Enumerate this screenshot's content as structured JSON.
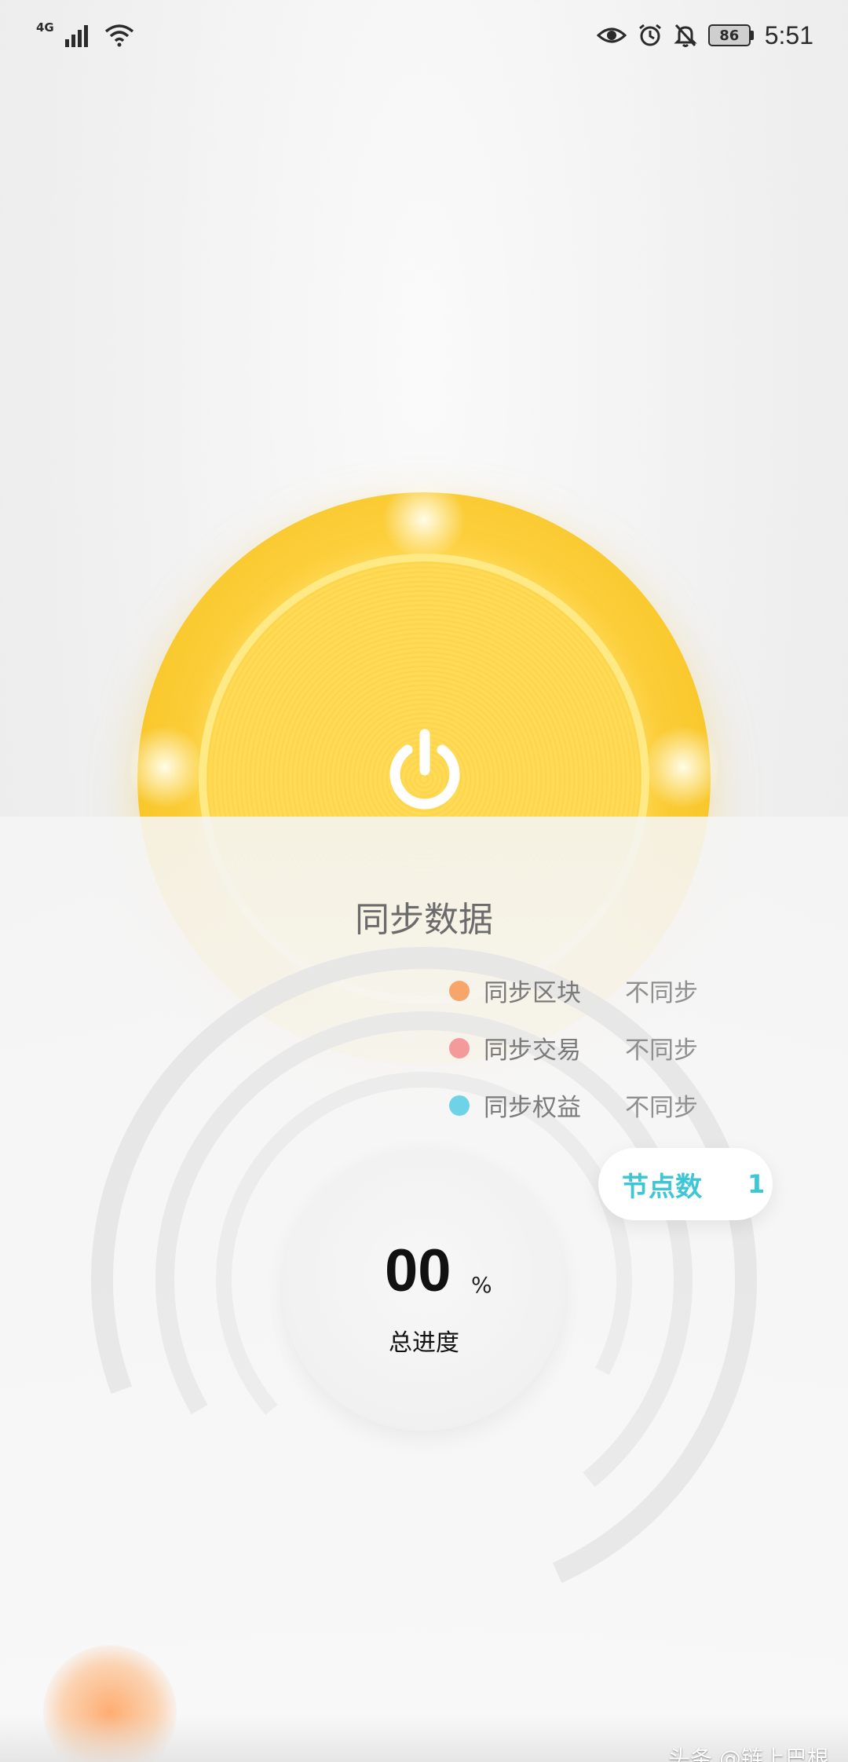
{
  "status_bar": {
    "network_label": "4G",
    "battery_level": "86",
    "time": "5:51"
  },
  "icons": {
    "power": "power-icon",
    "signal": "signal-icon",
    "wifi": "wifi-icon",
    "eye": "eye-icon",
    "alarm": "alarm-icon",
    "bell_off": "bell-off-icon"
  },
  "main": {
    "title": "同步数据",
    "sync_items": [
      {
        "label": "同步区块",
        "value": "不同步",
        "color": "#f7a56b"
      },
      {
        "label": "同步交易",
        "value": "不同步",
        "color": "#f59a9a"
      },
      {
        "label": "同步权益",
        "value": "不同步",
        "color": "#6fd3e8"
      }
    ],
    "node": {
      "label": "节点数",
      "count": "1"
    },
    "progress": {
      "value": "00",
      "unit": "%",
      "label": "总进度"
    }
  },
  "watermark": "头条 @链上巴根",
  "colors": {
    "accent_gold": "#ffd447",
    "accent_teal": "#3cc6d6"
  }
}
